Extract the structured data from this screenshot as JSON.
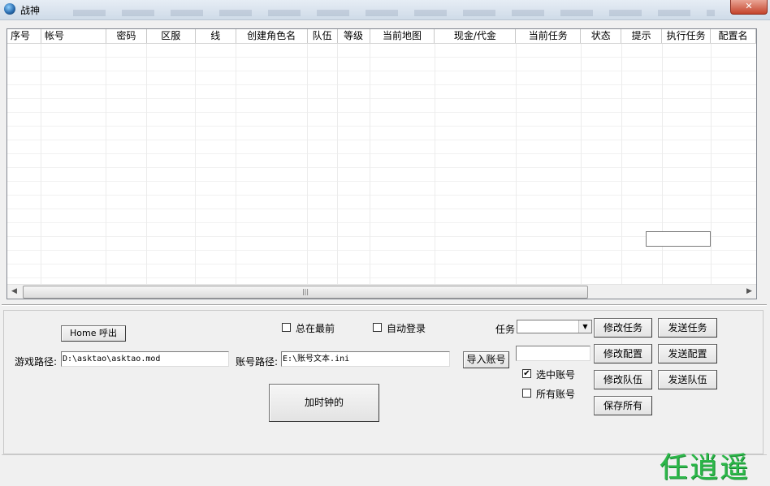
{
  "window": {
    "title": "战神",
    "close_label": "✕"
  },
  "table": {
    "columns": [
      {
        "label": "序号",
        "w": 42,
        "align": "left"
      },
      {
        "label": "帐号",
        "w": 80,
        "align": "left"
      },
      {
        "label": "密码",
        "w": 50
      },
      {
        "label": "区服",
        "w": 60
      },
      {
        "label": "线",
        "w": 50
      },
      {
        "label": "创建角色名",
        "w": 88
      },
      {
        "label": "队伍",
        "w": 37
      },
      {
        "label": "等级",
        "w": 40
      },
      {
        "label": "当前地图",
        "w": 80
      },
      {
        "label": "现金/代金",
        "w": 100
      },
      {
        "label": "当前任务",
        "w": 80
      },
      {
        "label": "状态",
        "w": 50
      },
      {
        "label": "提示",
        "w": 50
      },
      {
        "label": "执行任务",
        "w": 60
      },
      {
        "label": "配置名",
        "w": 56
      }
    ]
  },
  "scrollbar": {
    "left_arrow": "◀",
    "right_arrow": "▶",
    "grip": "|||"
  },
  "controls": {
    "home_button": "Home 呼出",
    "always_on_top_label": "总在最前",
    "always_on_top_checked": false,
    "auto_login_label": "自动登录",
    "auto_login_checked": false,
    "task_label": "任务",
    "task_value": "",
    "modify_task": "修改任务",
    "send_task": "发送任务",
    "game_path_label": "游戏路径:",
    "game_path_value": "D:\\asktao\\asktao.mod",
    "account_path_label": "账号路径:",
    "account_path_value": "E:\\账号文本.ini",
    "import_accounts": "导入账号",
    "config_value": "",
    "modify_config": "修改配置",
    "send_config": "发送配置",
    "selected_accounts_label": "选中账号",
    "selected_accounts_checked": true,
    "all_accounts_label": "所有账号",
    "all_accounts_checked": false,
    "modify_team": "修改队伍",
    "send_team": "发送队伍",
    "add_clock": "加时钟的",
    "save_all": "保存所有"
  },
  "watermark": "任逍遥"
}
